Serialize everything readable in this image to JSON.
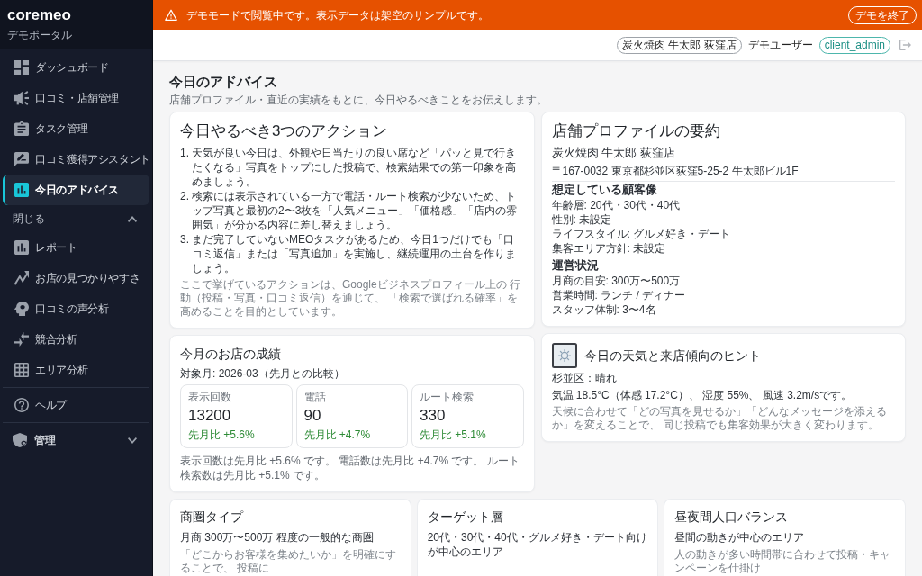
{
  "banner": {
    "message": "デモモードで閲覧中です。表示データは架空のサンプルです。",
    "button": "デモを終了"
  },
  "sidebar": {
    "brand": "coremeo",
    "tagline": "デモポータル",
    "items": [
      {
        "label": "ダッシュボード",
        "selected": false
      },
      {
        "label": "口コミ・店舗管理",
        "selected": false
      },
      {
        "label": "タスク管理",
        "selected": false
      },
      {
        "label": "口コミ獲得アシスタント",
        "selected": false
      },
      {
        "label": "今日のアドバイス",
        "selected": true
      }
    ],
    "group": {
      "label": "閉じる",
      "expanded": true,
      "items": [
        {
          "label": "レポート",
          "selected": false
        },
        {
          "label": "お店の見つかりやすさ",
          "selected": false
        },
        {
          "label": "口コミの声分析",
          "selected": false
        },
        {
          "label": "競合分析",
          "selected": false
        },
        {
          "label": "エリア分析",
          "selected": false
        }
      ]
    },
    "help": {
      "label": "ヘルプ",
      "selected": false
    },
    "admin": {
      "label": "管理",
      "expanded": false
    }
  },
  "header": {
    "store": "炭火焼肉 牛太郎 荻窪店",
    "user_label": "デモユーザー",
    "role": "client_admin"
  },
  "page": {
    "title": "今日のアドバイス",
    "subtitle": "店舗プロファイル・直近の実績をもとに、今日やるべきことをお伝えします。"
  },
  "actions": {
    "title": "今日やるべき3つのアクション",
    "items": [
      {
        "number": "1.",
        "text": "天気が良い今日は、外観や日当たりの良い席など「パッと見で行きたくなる」写真をトップにした投稿で、検索結果での第一印象を高めましょう。"
      },
      {
        "number": "2.",
        "text": "検索には表示されている一方で電話・ルート検索が少ないため、トップ写真と最初の2〜3枚を「人気メニュー」「価格感」「店内の雰囲気」が分かる内容に差し替えましょう。"
      },
      {
        "number": "3.",
        "text": "まだ完了していないMEOタスクがあるため、今日1つだけでも「口コミ返信」または「写真追加」を実施し、継続運用の土台を作りましょう。"
      }
    ],
    "note": "ここで挙げているアクションは、Googleビジネスプロフィール上の 行動（投稿・写真・口コミ返信）を通じて、 「検索で選ばれる確率」を高めることを目的としています。"
  },
  "results": {
    "title": "今月のお店の成績",
    "period": "対象月: 2026-03（先月との比較）",
    "metrics": [
      {
        "label": "表示回数",
        "value": "13200",
        "change": "先月比 +5.6%"
      },
      {
        "label": "電話",
        "value": "90",
        "change": "先月比 +4.7%"
      },
      {
        "label": "ルート検索",
        "value": "330",
        "change": "先月比 +5.1%"
      }
    ],
    "summary": "表示回数は先月比 +5.6% です。 電話数は先月比 +4.7% です。 ルート検索数は先月比 +5.1% です。"
  },
  "profile": {
    "title": "店舗プロファイルの要約",
    "store_name": "炭火焼肉 牛太郎 荻窪店",
    "address": "〒167-0032 東京都杉並区荻窪5-25-2 牛太郎ビル1F",
    "sections": [
      {
        "heading": "想定している顧客像",
        "lines": [
          "年齢層: 20代・30代・40代",
          "性別: 未設定",
          "ライフスタイル: グルメ好き・デート",
          "集客エリア方針: 未設定"
        ]
      },
      {
        "heading": "運営状況",
        "lines": [
          "月商の目安: 300万〜500万",
          "営業時間: ランチ / ディナー",
          "スタッフ体制: 3〜4名"
        ]
      }
    ]
  },
  "weather": {
    "title": "今日の天気と来店傾向のヒント",
    "area": "杉並区：晴れ",
    "conditions": "気温 18.5°C（体感 17.2°C）、 湿度 55%、 風速 3.2m/sです。",
    "note": "天候に合わせて「どの写真を見せるか」「どんなメッセージを添えるか」を変えることで、 同じ投稿でも集客効果が大きく変わります。"
  },
  "insights": [
    {
      "title": "商圏タイプ",
      "summary": "月商 300万〜500万 程度の一般的な商圏",
      "description": "「どこからお客様を集めたいか」を明確にすることで、 投稿に"
    },
    {
      "title": "ターゲット層",
      "summary": "20代・30代・40代・グルメ好き・デート向けが中心のエリア"
    },
    {
      "title": "昼夜間人口バランス",
      "summary": "昼間の動きが中心のエリア",
      "description": "人の動きが多い時間帯に合わせて投稿・キャンペーンを仕掛け"
    }
  ]
}
